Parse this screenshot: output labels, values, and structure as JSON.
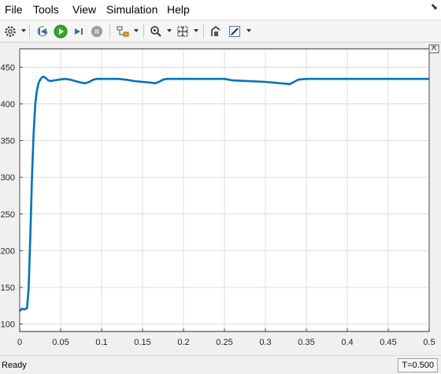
{
  "menu": {
    "file": "File",
    "tools": "Tools",
    "view": "View",
    "simulation": "Simulation",
    "help": "Help"
  },
  "toolbar": {
    "icons": [
      "gear-icon",
      "step-back-icon",
      "run-icon",
      "step-forward-icon",
      "stop-icon",
      "signal-selector-icon",
      "zoom-icon",
      "fit-to-view-icon",
      "highlight-block-icon",
      "style-icon"
    ]
  },
  "colors": {
    "line": "#0072bd",
    "run": "#2eaa2e",
    "grid": "#dcdcdc"
  },
  "chart_data": {
    "type": "line",
    "xlim": [
      0,
      0.5
    ],
    "ylim": [
      90,
      475
    ],
    "x_ticks": [
      "0",
      "0.05",
      "0.1",
      "0.15",
      "0.2",
      "0.25",
      "0.3",
      "0.35",
      "0.4",
      "0.45",
      "0.5"
    ],
    "y_ticks": [
      "100",
      "150",
      "200",
      "250",
      "300",
      "350",
      "400",
      "450"
    ],
    "grid": true,
    "series": [
      {
        "x": [
          0,
          0.003,
          0.006,
          0.009,
          0.011,
          0.013,
          0.015,
          0.017,
          0.019,
          0.021,
          0.023,
          0.025,
          0.027,
          0.029,
          0.031,
          0.033,
          0.035,
          0.038,
          0.042,
          0.048,
          0.055,
          0.062,
          0.068,
          0.075,
          0.08,
          0.085,
          0.09,
          0.095,
          0.1,
          0.11,
          0.12,
          0.13,
          0.14,
          0.15,
          0.16,
          0.165,
          0.17,
          0.175,
          0.18,
          0.2,
          0.22,
          0.24,
          0.25,
          0.26,
          0.3,
          0.33,
          0.335,
          0.34,
          0.35,
          0.4,
          0.45,
          0.5
        ],
        "y": [
          118,
          121,
          120,
          122,
          150,
          220,
          300,
          360,
          400,
          418,
          428,
          433,
          436,
          437,
          436,
          434,
          432,
          431,
          432,
          433,
          434,
          433,
          431,
          429,
          428,
          430,
          433,
          434,
          434,
          434,
          434,
          433,
          431,
          430,
          429,
          428,
          430,
          433,
          434,
          434,
          434,
          434,
          434,
          432,
          430,
          427,
          430,
          433,
          434,
          434,
          434,
          434
        ]
      }
    ]
  },
  "status": {
    "text": "Ready",
    "time": "T=0.500"
  }
}
